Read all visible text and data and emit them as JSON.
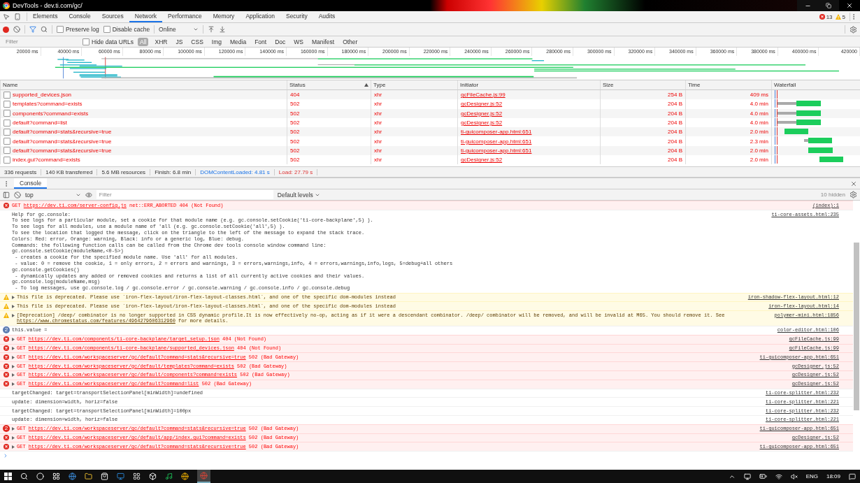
{
  "window": {
    "title": "DevTools - dev.ti.com/gc/"
  },
  "tabs": [
    {
      "label": "Elements",
      "selected": false
    },
    {
      "label": "Console",
      "selected": false
    },
    {
      "label": "Sources",
      "selected": false
    },
    {
      "label": "Network",
      "selected": true
    },
    {
      "label": "Performance",
      "selected": false
    },
    {
      "label": "Memory",
      "selected": false
    },
    {
      "label": "Application",
      "selected": false
    },
    {
      "label": "Security",
      "selected": false
    },
    {
      "label": "Audits",
      "selected": false
    }
  ],
  "counts": {
    "errors": "13",
    "warnings": "5"
  },
  "toolbar": {
    "recording": true,
    "preserve_log": {
      "label": "Preserve log",
      "checked": false
    },
    "disable_cache": {
      "label": "Disable cache",
      "checked": false
    },
    "throttling": "Online"
  },
  "filter_bar": {
    "placeholder": "Filter",
    "hide_data_urls": {
      "label": "Hide data URLs",
      "checked": false
    },
    "types": [
      {
        "label": "All",
        "selected": true
      },
      {
        "label": "XHR",
        "selected": false
      },
      {
        "label": "JS",
        "selected": false
      },
      {
        "label": "CSS",
        "selected": false
      },
      {
        "label": "Img",
        "selected": false
      },
      {
        "label": "Media",
        "selected": false
      },
      {
        "label": "Font",
        "selected": false
      },
      {
        "label": "Doc",
        "selected": false
      },
      {
        "label": "WS",
        "selected": false
      },
      {
        "label": "Manifest",
        "selected": false
      },
      {
        "label": "Other",
        "selected": false
      }
    ]
  },
  "overview": {
    "ticks": [
      "20000 ms",
      "40000 ms",
      "60000 ms",
      "80000 ms",
      "100000 ms",
      "120000 ms",
      "140000 ms",
      "160000 ms",
      "180000 ms",
      "200000 ms",
      "220000 ms",
      "240000 ms",
      "260000 ms",
      "280000 ms",
      "300000 ms",
      "320000 ms",
      "340000 ms",
      "360000 ms",
      "380000 ms",
      "400000 ms",
      "420000"
    ]
  },
  "table": {
    "columns": [
      {
        "label": "Name",
        "sorted": false
      },
      {
        "label": "Status",
        "sorted": true
      },
      {
        "label": "Type",
        "sorted": false
      },
      {
        "label": "Initiator",
        "sorted": false
      },
      {
        "label": "Size",
        "sorted": false
      },
      {
        "label": "Time",
        "sorted": false
      },
      {
        "label": "Waterfall",
        "sorted": false
      }
    ],
    "rows": [
      {
        "name": "supported_devices.json",
        "status": "404",
        "type": "xhr",
        "initiator": "gcFileCache.js:99",
        "size": "254 B",
        "time": "409 ms"
      },
      {
        "name": "templates?command=exists",
        "status": "502",
        "type": "xhr",
        "initiator": "gcDesigner.js:52",
        "size": "204 B",
        "time": "4.0 min"
      },
      {
        "name": "components?command=exists",
        "status": "502",
        "type": "xhr",
        "initiator": "gcDesigner.js:52",
        "size": "204 B",
        "time": "4.0 min"
      },
      {
        "name": "default?command=list",
        "status": "502",
        "type": "xhr",
        "initiator": "gcDesigner.js:52",
        "size": "204 B",
        "time": "4.0 min"
      },
      {
        "name": "default?command=stats&recursive=true",
        "status": "502",
        "type": "xhr",
        "initiator": "ti-guicomposer-app.html:651",
        "size": "204 B",
        "time": "2.0 min"
      },
      {
        "name": "default?command=stats&recursive=true",
        "status": "502",
        "type": "xhr",
        "initiator": "ti-guicomposer-app.html:651",
        "size": "204 B",
        "time": "2.3 min"
      },
      {
        "name": "default?command=stats&recursive=true",
        "status": "502",
        "type": "xhr",
        "initiator": "ti-guicomposer-app.html:651",
        "size": "204 B",
        "time": "2.0 min"
      },
      {
        "name": "index.gui?command=exists",
        "status": "502",
        "type": "xhr",
        "initiator": "gcDesigner.js:52",
        "size": "204 B",
        "time": "2.0 min"
      }
    ]
  },
  "summary": [
    {
      "text": "336 requests",
      "kind": "plain"
    },
    {
      "text": "140 KB transferred",
      "kind": "plain"
    },
    {
      "text": "5.6 MB resources",
      "kind": "plain"
    },
    {
      "text": "Finish: 6.8 min",
      "kind": "plain"
    },
    {
      "text": "DOMContentLoaded: 4.81 s",
      "kind": "dom"
    },
    {
      "text": "Load: 27.79 s",
      "kind": "load"
    }
  ],
  "drawer": {
    "tabs": [
      {
        "label": "Console",
        "selected": true
      }
    ]
  },
  "console_toolbar": {
    "context": "top",
    "placeholder": "Filter",
    "levels": "Default levels",
    "hidden": "10 hidden"
  },
  "messages": [
    {
      "kind": "error",
      "expandable": false,
      "method": "GET",
      "url": "https://dev.ti.com/server-config.js",
      "status": "net::ERR_ABORTED 404 (Not Found)",
      "source": "(index):1"
    },
    {
      "kind": "log",
      "text": "Help for gc.console:\nTo see logs for a particular module, set a cookie for that module name (e.g. gc.console.setCookie('ti-core-backplane',5) ).\nTo see logs for all modules, use a module name of 'all (e.g. gc.console.setCookie('all',5) ).\nTo see the location that logged the message, click on the triangle to the left of the message to expand the stack trace.\nColors: Red: error, Orange: warning, Black: info or a generic log, Blue: debug.\nCommands: the following function calls can be called from the Chrome dev tools console window command line:\ngc.console.setCookie(moduleName,<0-5>)\n - creates a cookie for the specified module name. Use 'all' for all modules.\n - value: 0 = remove the cookie, 1 = only errors, 2 = errors and warnings, 3 = errors,warnings,info, 4 = errors,warnings,info,logs, 5=debug+all others\ngc.console.getCookies()\n - dynamically updates any added or removed cookies and returns a list of all currently active cookies and their values.\ngc.console.log(moduleName,msg)\n - To log messages, use gc.console.log / gc.console.error / gc.console.warning / gc.console.info / gc.console.debug",
      "source": "ti-core-assets.html:235"
    },
    {
      "kind": "warning",
      "expandable": true,
      "text": "This file is deprecated. Please use `iron-flex-layout/iron-flex-layout-classes.html`, and one of the specific dom-modules instead",
      "source": "iron-shadow-flex-layout.html:12"
    },
    {
      "kind": "warning",
      "expandable": true,
      "text": "This file is deprecated. Please use `iron-flex-layout/iron-flex-layout-classes.html`, and one of the specific dom-modules instead",
      "source": "iron-flex-layout.html:14"
    },
    {
      "kind": "warning",
      "expandable": true,
      "text": "[Deprecation] /deep/ combinator is no longer supported in CSS dynamic profile.It is now effectively no-op, acting as if it were a descendant combinator. /deep/ combinator will be removed, and will be invalid at M65. You should remove it. See",
      "url": "https://www.chromestatus.com/features/4964279606312960",
      "after": "for more details.",
      "source": "polymer-mini.html:1856"
    },
    {
      "kind": "info",
      "count": "2",
      "text": "this.value =",
      "source": "color-editor.html:106"
    },
    {
      "kind": "error",
      "expandable": true,
      "method": "GET",
      "url": "https://dev.ti.com/components/ti-core-backplane/target_setup.json",
      "status": "404 (Not Found)",
      "source": "gcFileCache.js:99"
    },
    {
      "kind": "error",
      "expandable": true,
      "method": "GET",
      "url": "https://dev.ti.com/components/ti-core-backplane/supported_devices.json",
      "status": "404 (Not Found)",
      "source": "gcFileCache.js:99"
    },
    {
      "kind": "error",
      "expandable": true,
      "method": "GET",
      "url": "https://dev.ti.com/workspaceserver/gc/default?command=stats&recursive=true",
      "status": "502 (Bad Gateway)",
      "source": "ti-guicomposer-app.html:651"
    },
    {
      "kind": "error",
      "expandable": true,
      "method": "GET",
      "url": "https://dev.ti.com/workspaceserver/gc/default/templates?command=exists",
      "status": "502 (Bad Gateway)",
      "source": "gcDesigner.js:52"
    },
    {
      "kind": "error",
      "expandable": true,
      "method": "GET",
      "url": "https://dev.ti.com/workspaceserver/gc/default/components?command=exists",
      "status": "502 (Bad Gateway)",
      "source": "gcDesigner.js:52"
    },
    {
      "kind": "error",
      "expandable": true,
      "method": "GET",
      "url": "https://dev.ti.com/workspaceserver/gc/default?command=list",
      "status": "502 (Bad Gateway)",
      "source": "gcDesigner.js:52"
    },
    {
      "kind": "log",
      "text": "targetChanged: target=transportSelectionPanel[minWidth]=undefined",
      "source": "ti-core-splitter.html:232"
    },
    {
      "kind": "log",
      "text": "update: dimension=width, horiz=false",
      "source": "ti-core-splitter.html:221"
    },
    {
      "kind": "log",
      "text": "targetChanged: target=transportSelectionPanel[minWidth]=100px",
      "source": "ti-core-splitter.html:232"
    },
    {
      "kind": "log",
      "text": "update: dimension=width, horiz=false",
      "source": "ti-core-splitter.html:221"
    },
    {
      "kind": "error",
      "count": "2",
      "expandable": true,
      "method": "GET",
      "url": "https://dev.ti.com/workspaceserver/gc/default?command=stats&recursive=true",
      "status": "502 (Bad Gateway)",
      "source": "ti-guicomposer-app.html:651"
    },
    {
      "kind": "error",
      "expandable": true,
      "method": "GET",
      "url": "https://dev.ti.com/workspaceserver/gc/default/app/index.gui?command=exists",
      "status": "502 (Bad Gateway)",
      "source": "gcDesigner.js:52"
    },
    {
      "kind": "error",
      "expandable": true,
      "method": "GET",
      "url": "https://dev.ti.com/workspaceserver/gc/default?command=stats&recursive=true",
      "status": "502 (Bad Gateway)",
      "source": "ti-guicomposer-app.html:651"
    }
  ],
  "taskbar": {
    "language": "ENG",
    "clock": "18:09"
  }
}
